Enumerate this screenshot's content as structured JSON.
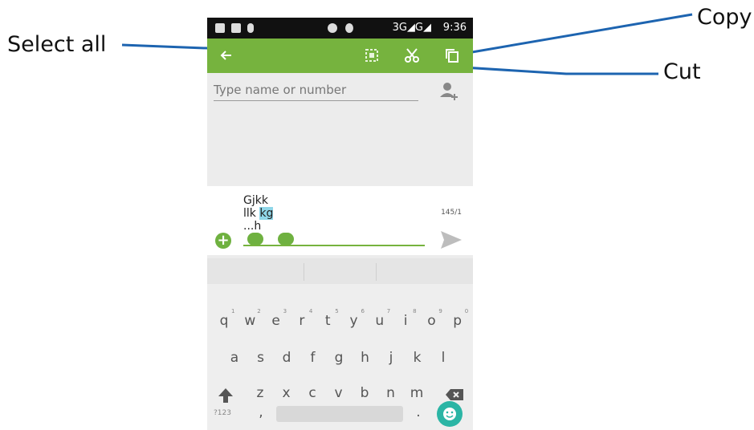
{
  "callouts": {
    "select_all": "Select all",
    "copy": "Copy",
    "cut": "Cut"
  },
  "status_bar": {
    "network": "3G◢G◢",
    "time": "9:36"
  },
  "recipient": {
    "placeholder": "Type name or number"
  },
  "compose": {
    "line1": "Gjkk",
    "line2_plain": "llk ",
    "line2_selected": "kg",
    "line3": "...h",
    "counter": "145/1"
  },
  "keyboard": {
    "row1": [
      "q",
      "w",
      "e",
      "r",
      "t",
      "y",
      "u",
      "i",
      "o",
      "p"
    ],
    "row1_numbers": [
      "1",
      "2",
      "3",
      "4",
      "5",
      "6",
      "7",
      "8",
      "9",
      "0"
    ],
    "row2": [
      "a",
      "s",
      "d",
      "f",
      "g",
      "h",
      "j",
      "k",
      "l"
    ],
    "row3": [
      "z",
      "x",
      "c",
      "v",
      "b",
      "n",
      "m"
    ],
    "symbols_key": "?123",
    "comma": ",",
    "period": "."
  },
  "colors": {
    "action_bar": "#76b33e",
    "accent_teal": "#2bb5a5",
    "selection": "#8fd6e8"
  },
  "icons": [
    "back-arrow-icon",
    "select-all-icon",
    "cut-icon",
    "copy-icon",
    "add-contact-icon",
    "add-attachment-icon",
    "send-icon",
    "shift-icon",
    "backspace-icon",
    "emoji-icon"
  ]
}
